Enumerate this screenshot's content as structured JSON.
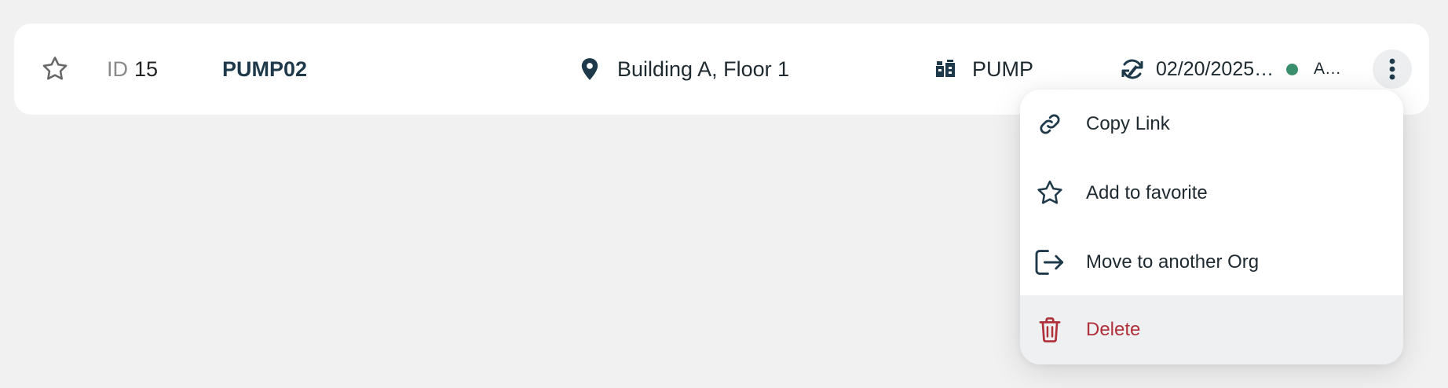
{
  "row": {
    "id_prefix": "ID",
    "id_value": "15",
    "name": "PUMP02",
    "location": "Building A, Floor 1",
    "type": "PUMP",
    "date": "02/20/2025…",
    "status": "A…"
  },
  "menu": {
    "items": [
      {
        "label": "Copy Link",
        "icon": "link-icon"
      },
      {
        "label": "Add to favorite",
        "icon": "star-icon"
      },
      {
        "label": "Move to another Org",
        "icon": "move-out-icon"
      },
      {
        "label": "Delete",
        "icon": "trash-icon"
      }
    ]
  },
  "colors": {
    "background": "#f1f1f1",
    "text_primary": "#1e3a4a",
    "status_green": "#3a8f6c",
    "delete_red": "#b0303a",
    "delete_bg": "#eef0f2"
  }
}
